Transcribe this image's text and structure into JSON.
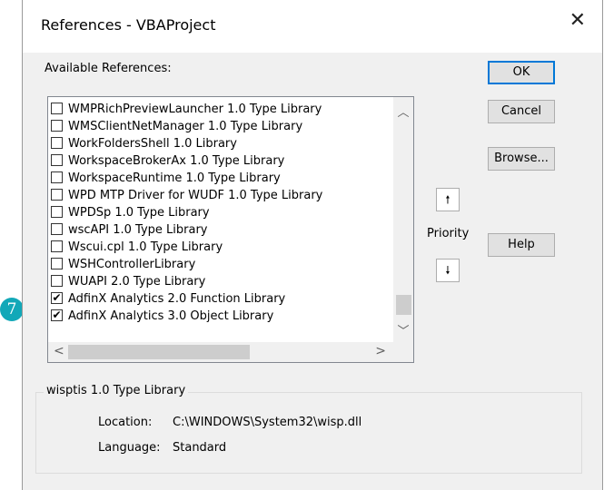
{
  "dialog": {
    "title": "References - VBAProject",
    "close_glyph": "✕"
  },
  "available_label": "Available References:",
  "references": [
    {
      "label": "WMPRichPreviewLauncher 1.0 Type Library",
      "checked": false
    },
    {
      "label": "WMSClientNetManager 1.0 Type Library",
      "checked": false
    },
    {
      "label": "WorkFoldersShell 1.0 Library",
      "checked": false
    },
    {
      "label": "WorkspaceBrokerAx 1.0 Type Library",
      "checked": false
    },
    {
      "label": "WorkspaceRuntime 1.0 Type Library",
      "checked": false
    },
    {
      "label": "WPD MTP Driver for WUDF 1.0 Type Library",
      "checked": false
    },
    {
      "label": "WPDSp 1.0 Type Library",
      "checked": false
    },
    {
      "label": "wscAPI 1.0 Type Library",
      "checked": false
    },
    {
      "label": "Wscui.cpl 1.0 Type Library",
      "checked": false
    },
    {
      "label": "WSHControllerLibrary",
      "checked": false
    },
    {
      "label": "WUAPI 2.0 Type Library",
      "checked": false
    },
    {
      "label": "AdfinX Analytics 2.0 Function Library",
      "checked": true
    },
    {
      "label": "AdfinX Analytics 3.0 Object Library",
      "checked": true
    }
  ],
  "buttons": {
    "ok": "OK",
    "cancel": "Cancel",
    "browse": "Browse...",
    "help": "Help"
  },
  "priority": {
    "label": "Priority",
    "up_glyph": "🠕",
    "down_glyph": "🠗"
  },
  "scroll": {
    "up_glyph": "︿",
    "down_glyph": "﹀",
    "left_glyph": "<",
    "right_glyph": ">"
  },
  "selected_info": {
    "group_title": "wisptis 1.0 Type Library",
    "location_label": "Location:",
    "location_value": "C:\\WINDOWS\\System32\\wisp.dll",
    "language_label": "Language:",
    "language_value": "Standard"
  },
  "step_badge": "7",
  "colors": {
    "accent": "#0078d7",
    "badge": "#12a8b8",
    "dialog_bg": "#f0f0f0"
  }
}
